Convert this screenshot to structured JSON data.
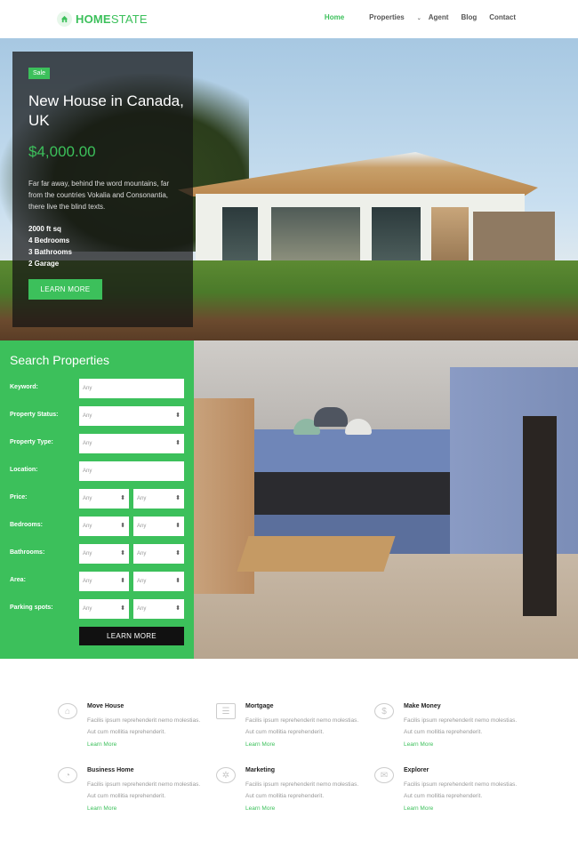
{
  "brand": {
    "logo_home": "HOME",
    "logo_state": "STATE"
  },
  "nav": {
    "items": [
      {
        "label": "Home",
        "active": true
      },
      {
        "label": "Properties",
        "dropdown": true
      },
      {
        "label": "Agent"
      },
      {
        "label": "Blog"
      },
      {
        "label": "Contact"
      }
    ]
  },
  "hero": {
    "badge": "Sale",
    "title": "New House in Canada, UK",
    "price": "$4,000.00",
    "description": "Far far away, behind the word mountains, far from the countries Vokalia and Consonantia, there live the blind texts.",
    "specs": [
      "2000 ft sq",
      "4 Bedrooms",
      "3 Bathrooms",
      "2 Garage"
    ],
    "button": "LEARN MORE"
  },
  "search": {
    "title": "Search Properties",
    "fields": [
      {
        "label": "Keyword:",
        "type": "input",
        "placeholder": "Any"
      },
      {
        "label": "Property Status:",
        "type": "select",
        "value": "Any"
      },
      {
        "label": "Property Type:",
        "type": "select",
        "value": "Any"
      },
      {
        "label": "Location:",
        "type": "input",
        "placeholder": "Any"
      },
      {
        "label": "Price:",
        "type": "pair",
        "values": [
          "Any",
          "Any"
        ]
      },
      {
        "label": "Bedrooms:",
        "type": "pair",
        "values": [
          "Any",
          "Any"
        ]
      },
      {
        "label": "Bathrooms:",
        "type": "pair",
        "values": [
          "Any",
          "Any"
        ]
      },
      {
        "label": "Area:",
        "type": "pair",
        "values": [
          "Any",
          "Any"
        ]
      },
      {
        "label": "Parking spots:",
        "type": "pair",
        "values": [
          "Any",
          "Any"
        ]
      }
    ],
    "button": "LEARN MORE"
  },
  "features": [
    {
      "icon": "home-icon",
      "title": "Move House",
      "text": "Facilis ipsum reprehenderit nemo molestias. Aut cum mollitia reprehenderit.",
      "link": "Learn More"
    },
    {
      "icon": "document-icon",
      "title": "Mortgage",
      "text": "Facilis ipsum reprehenderit nemo molestias. Aut cum mollitia reprehenderit.",
      "link": "Learn More"
    },
    {
      "icon": "money-icon",
      "title": "Make Money",
      "text": "Facilis ipsum reprehenderit nemo molestias. Aut cum mollitia reprehenderit.",
      "link": "Learn More"
    },
    {
      "icon": "chart-icon",
      "title": "Business Home",
      "text": "Facilis ipsum reprehenderit nemo molestias. Aut cum mollitia reprehenderit.",
      "link": "Learn More"
    },
    {
      "icon": "gear-icon",
      "title": "Marketing",
      "text": "Facilis ipsum reprehenderit nemo molestias. Aut cum mollitia reprehenderit.",
      "link": "Learn More"
    },
    {
      "icon": "chat-icon",
      "title": "Explorer",
      "text": "Facilis ipsum reprehenderit nemo molestias. Aut cum mollitia reprehenderit.",
      "link": "Learn More"
    }
  ],
  "colors": {
    "accent": "#3cc05b",
    "dark_button": "#111111",
    "overlay": "#141414"
  }
}
